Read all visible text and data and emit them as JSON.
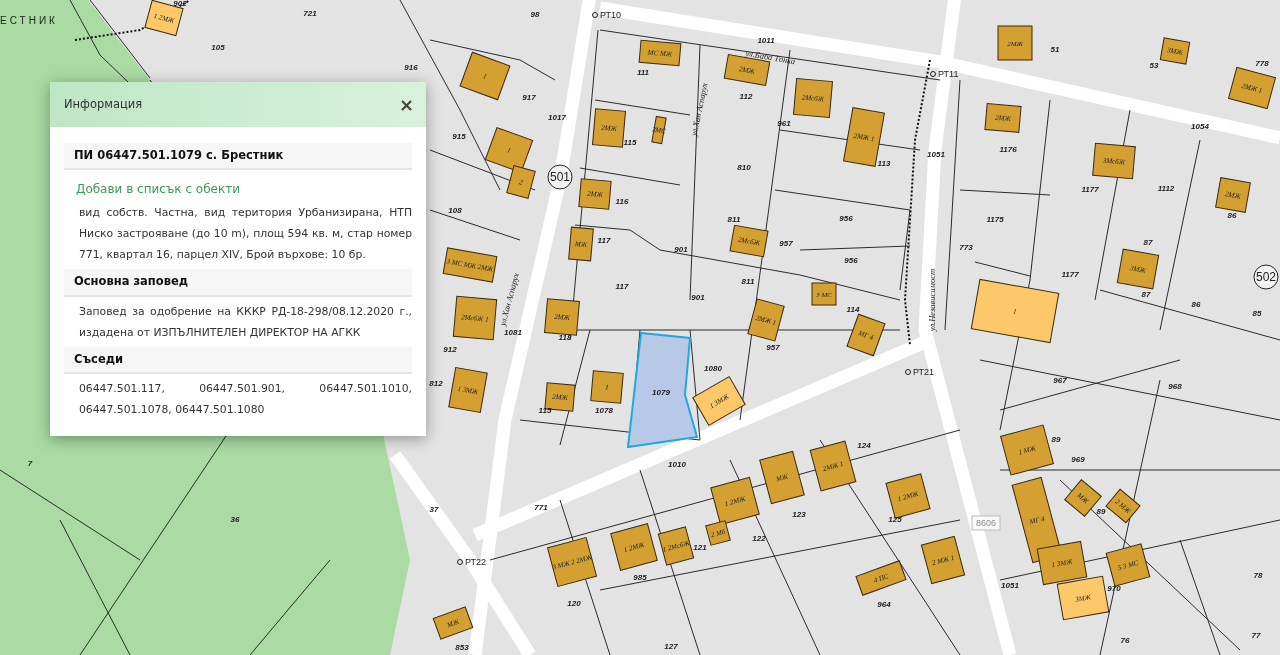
{
  "map": {
    "locality_label": "ЕСТНИК",
    "parcel_labels": [
      "902",
      "721",
      "105",
      "916",
      "98",
      "917",
      "915",
      "108",
      "1017",
      "111",
      "115",
      "1011",
      "112",
      "961",
      "810",
      "116",
      "117",
      "117",
      "901",
      "901",
      "811",
      "811",
      "957",
      "956",
      "956",
      "114",
      "113",
      "118",
      "1051",
      "1051",
      "51",
      "53",
      "778",
      "1054",
      "1176",
      "1177",
      "1177",
      "1112",
      "1175",
      "773",
      "87",
      "87",
      "86",
      "86",
      "85",
      "912",
      "812",
      "115",
      "1078",
      "1081",
      "1080",
      "957",
      "1010",
      "771",
      "37",
      "36",
      "7",
      "967",
      "968",
      "969",
      "89",
      "89",
      "124",
      "125",
      "123",
      "122",
      "121",
      "985",
      "120",
      "127",
      "964",
      "970",
      "78",
      "76",
      "77",
      "853"
    ],
    "point_labels": [
      "РТ10",
      "РТ11",
      "РТ21",
      "РТ22"
    ],
    "streets": [
      "ул.Баба Тонка",
      "ул.Хан Аспарух",
      "ул.Хан Аспарух",
      "ул.Независимост"
    ],
    "zone_numbers": [
      "501",
      "502"
    ],
    "road_number": "8606",
    "selected_parcel": {
      "label": "1079",
      "selected": true
    },
    "buildings": [
      {
        "label": "1 2МЖ",
        "highlighted": true
      },
      {
        "label": "1",
        "highlighted": false
      },
      {
        "label": "1",
        "highlighted": false
      },
      {
        "label": "2",
        "highlighted": false
      },
      {
        "label": "МС МЖ",
        "highlighted": false
      },
      {
        "label": "2МЖ",
        "highlighted": false
      },
      {
        "label": "3МС",
        "highlighted": false
      },
      {
        "label": "2МЖ",
        "highlighted": false
      },
      {
        "label": "МЖ",
        "highlighted": false
      },
      {
        "label": "2МЖ",
        "highlighted": false
      },
      {
        "label": "2МЖ",
        "highlighted": false
      },
      {
        "label": "2МсбЖ",
        "highlighted": false
      },
      {
        "label": "2МЖ 1",
        "highlighted": false
      },
      {
        "label": "2МсбЖ",
        "highlighted": false
      },
      {
        "label": "3 МС",
        "highlighted": false
      },
      {
        "label": "МГ 4",
        "highlighted": false
      },
      {
        "label": "2МЖ 1",
        "highlighted": false
      },
      {
        "label": "2МЖ",
        "highlighted": false
      },
      {
        "label": "3МЖ",
        "highlighted": false
      },
      {
        "label": "2МЖ 1",
        "highlighted": false
      },
      {
        "label": "2МЖ",
        "highlighted": false
      },
      {
        "label": "3МсбЖ",
        "highlighted": false
      },
      {
        "label": "2МЖ",
        "highlighted": false
      },
      {
        "label": "3МЖ",
        "highlighted": false
      },
      {
        "label": "1",
        "highlighted": true
      },
      {
        "label": "1 МЖ",
        "highlighted": false
      },
      {
        "label": "МГ 4",
        "highlighted": false
      },
      {
        "label": "1 3МЖ",
        "highlighted": false
      },
      {
        "label": "МЖ",
        "highlighted": false
      },
      {
        "label": "2 МЖ",
        "highlighted": false
      },
      {
        "label": "5 3 МС",
        "highlighted": false
      },
      {
        "label": "3МЖ",
        "highlighted": true
      },
      {
        "label": "2МЖ 1",
        "highlighted": false
      },
      {
        "label": "МЖ",
        "highlighted": false
      },
      {
        "label": "1 2МЖ",
        "highlighted": false
      },
      {
        "label": "2 МЖ 1",
        "highlighted": false
      },
      {
        "label": "4 ПС",
        "highlighted": false
      },
      {
        "label": "1 2МЖ",
        "highlighted": false
      },
      {
        "label": "1 2МсбЖ",
        "highlighted": false
      },
      {
        "label": "2 Мб",
        "highlighted": false
      },
      {
        "label": "1 2МЖ",
        "highlighted": false
      },
      {
        "label": "3 МЖ 2 2МЖ",
        "highlighted": false
      },
      {
        "label": "1 3МЖ",
        "highlighted": false
      },
      {
        "label": "3 МС МЖ 2МЖ",
        "highlighted": false
      },
      {
        "label": "2МсбЖ 1",
        "highlighted": false
      },
      {
        "label": "2МЖ",
        "highlighted": false
      },
      {
        "label": "1",
        "highlighted": false
      },
      {
        "label": "1 3МЖ",
        "highlighted": true
      },
      {
        "label": "МЖ",
        "highlighted": false
      }
    ]
  },
  "info_panel": {
    "title": "Информация",
    "close_glyph": "×",
    "parcel_heading": "ПИ 06447.501.1079 с. Брестник",
    "add_link": "Добави в списък с обекти",
    "description": "вид собств. Частна, вид територия Урбанизирана, НТП Ниско застрояване (до 10 m), площ 594 кв. м, стар номер 771, квартал 16, парцел XIV, Брой върхове: 10 бр.",
    "sections": [
      {
        "heading": "Основна заповед",
        "text": "Заповед за одобрение на КККР РД-18-298/08.12.2020 г., издадена от ИЗПЪЛНИТЕЛЕН ДИРЕКТОР НА АГКК"
      },
      {
        "heading": "Съседи",
        "text": "06447.501.117, 06447.501.901, 06447.501.1010, 06447.501.1078, 06447.501.1080"
      }
    ]
  }
}
